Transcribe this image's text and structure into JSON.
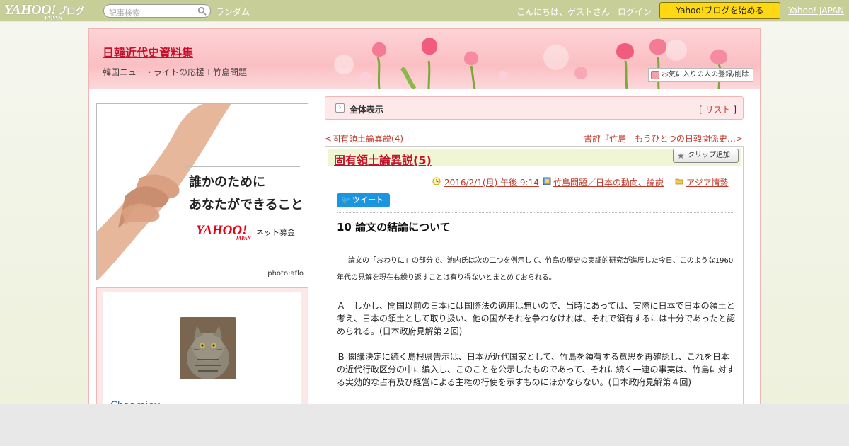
{
  "topbar": {
    "logo_text": "YAHOO!",
    "logo_sub": "JAPAN",
    "logo_blog": "ブログ",
    "search_placeholder": "記事検索",
    "random_link": "ランダム",
    "greeting": "こんにちは、ゲストさん",
    "login_link": "ログイン",
    "start_button": "Yahoo!ブログを始める",
    "yahoo_japan_link": "Yahoo! JAPAN"
  },
  "banner": {
    "blog_title": "日韓近代史資料集",
    "blog_description": "韓国ニュー・ライトの応援＋竹島問題",
    "favorite_button": "お気に入りの人の登録/削除"
  },
  "ad": {
    "copy_line1": "誰かのために",
    "copy_line2": "あなたができること",
    "brand": "YAHOO!",
    "brand_sub": "JAPAN",
    "service": "ネット募金",
    "credit": "photo:aflo"
  },
  "profile": {
    "name": "Chaamiey"
  },
  "view_bar": {
    "label": "全体表示",
    "list_open": "[",
    "list_link": "リスト",
    "list_close": "]"
  },
  "nav": {
    "prev": "<固有領土論異説(4)",
    "next": "書評『竹島 - もうひとつの日韓関係史…>"
  },
  "post": {
    "title": "固有領土論異説(5)",
    "clip_button": "クリップ追加",
    "datetime": "2016/2/1(月) 午後 9:14",
    "category": "竹島問題／日本の動向、論説",
    "folder": "アジア情勢",
    "tweet_button": "ツイート",
    "heading": "10 論文の結論について",
    "paragraph_intro": "論文の「おわりに」の部分で、池内氏は次の二つを例示して、竹島の歴史の実証的研究が進展した今日、このような1960年代の見解を現在も繰り返すことは有り得ないとまとめておられる。",
    "paragraph_a": "Ａ　しかし、開国以前の日本には国際法の適用は無いので、当時にあっては、実際に日本で日本の領土と考え、日本の領土として取り扱い、他の国がそれを争わなければ、それで領有するには十分であったと認められる。(日本政府見解第２回)",
    "paragraph_b": "Ｂ 閣議決定に続く島根県告示は、日本が近代国家として、竹島を領有する意思を再確認し、これを日本の近代行政区分の中に編入し、このことを公示したものであって、それに続く一連の事実は、竹島に対する実効的な占有及び経営による主権の行使を示すものにほかならない。(日本政府見解第４回)"
  },
  "colors": {
    "topbar": "#c8ce98",
    "accent_red": "#c4102b",
    "start_button": "#ffd814",
    "tweet_blue": "#1b95e0",
    "banner_pink": "#fbbfc3"
  }
}
